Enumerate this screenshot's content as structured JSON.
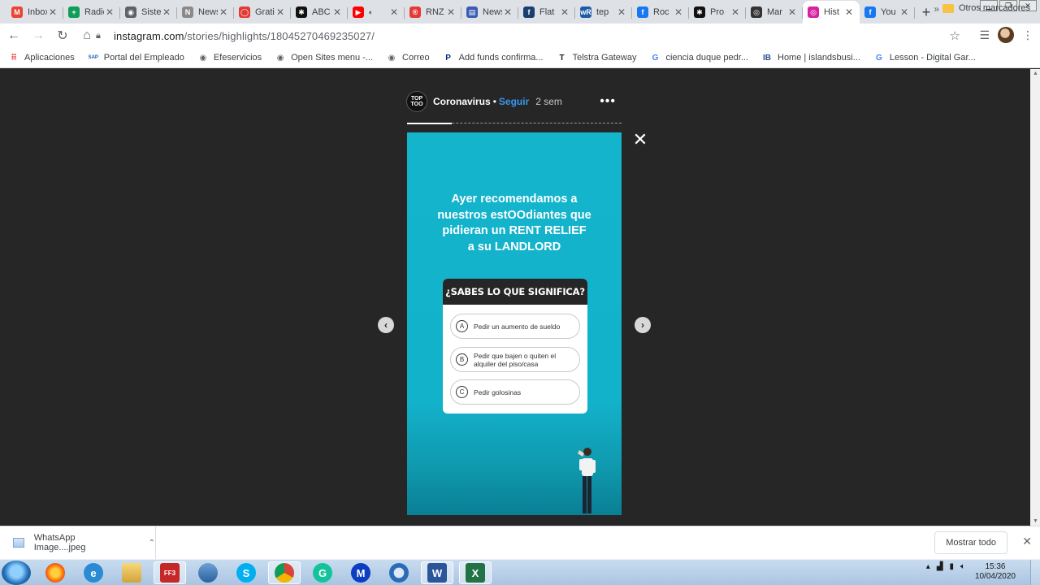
{
  "tabs": [
    {
      "label": "Inbox",
      "icon": "gmail-icon",
      "color": "#ea4335",
      "glyph": "M"
    },
    {
      "label": "Radio",
      "icon": "sheets-icon",
      "color": "#0f9d58",
      "glyph": "+"
    },
    {
      "label": "Sistema",
      "icon": "globe-icon",
      "color": "#5f6368",
      "glyph": "◉"
    },
    {
      "label": "News",
      "icon": "newsletter-icon",
      "color": "#8a8a8a",
      "glyph": "N"
    },
    {
      "label": "Gratis",
      "icon": "chat-bubble-icon",
      "color": "#e53935",
      "glyph": "◯"
    },
    {
      "label": "ABC",
      "icon": "abc-icon",
      "color": "#111111",
      "glyph": "✱"
    },
    {
      "label": "",
      "icon": "youtube-icon",
      "color": "#ff0000",
      "glyph": "▶"
    },
    {
      "label": "RNZ",
      "icon": "rnz-icon",
      "color": "#e53935",
      "glyph": "®"
    },
    {
      "label": "News",
      "icon": "news-flag-icon",
      "color": "#3b5bb5",
      "glyph": "▤"
    },
    {
      "label": "Flat",
      "icon": "flatmates-icon",
      "color": "#1a3f6f",
      "glyph": "f"
    },
    {
      "label": "tep",
      "icon": "wordreference-icon",
      "color": "#1e5aa8",
      "glyph": "wR"
    },
    {
      "label": "Roc",
      "icon": "facebook-icon",
      "color": "#1877f2",
      "glyph": "f"
    },
    {
      "label": "Pro",
      "icon": "abc-icon",
      "color": "#111111",
      "glyph": "✱"
    },
    {
      "label": "Mar",
      "icon": "radio-icon",
      "color": "#333333",
      "glyph": "◎"
    },
    {
      "label": "Hist",
      "icon": "instagram-icon",
      "color": "#d6249f",
      "glyph": "◎"
    },
    {
      "label": "You",
      "icon": "facebook-icon",
      "color": "#1877f2",
      "glyph": "f"
    }
  ],
  "address": {
    "domain": "instagram.com",
    "path": "/stories/highlights/18045270469235027/"
  },
  "bookmarks": [
    {
      "label": "Aplicaciones",
      "icon": "apps-grid-icon"
    },
    {
      "label": "Portal del Empleado",
      "icon": "sap-icon"
    },
    {
      "label": "Efeservicios",
      "icon": "globe-icon"
    },
    {
      "label": "Open Sites menu -...",
      "icon": "globe-icon"
    },
    {
      "label": "Correo",
      "icon": "globe-icon"
    },
    {
      "label": "Add funds confirma...",
      "icon": "paypal-icon"
    },
    {
      "label": "Telstra Gateway",
      "icon": "telstra-icon"
    },
    {
      "label": "ciencia duque pedr...",
      "icon": "google-icon"
    },
    {
      "label": "Home | islandsbusi...",
      "icon": "ib-icon"
    },
    {
      "label": "Lesson - Digital Gar...",
      "icon": "google-icon"
    }
  ],
  "bookmarks_more": "»",
  "bookmarks_other": "Otros marcadores",
  "story": {
    "logo_text": "TOP TOO",
    "account": "Coronavirus",
    "dot": "•",
    "follow": "Seguir",
    "time": "2 sem",
    "more": "•••",
    "progress": 0.21,
    "caption_lines": [
      "Ayer recomendamos a",
      "nuestros estOOdiantes que",
      "pidieran un RENT RELIEF",
      "a su LANDLORD"
    ],
    "quiz_title": "¿SABES LO QUE SIGNIFICA?",
    "options": [
      {
        "letter": "A",
        "text": "Pedir un aumento de sueldo"
      },
      {
        "letter": "B",
        "text": "Pedir que bajen o quiten el alquiler del piso/casa"
      },
      {
        "letter": "C",
        "text": "Pedir golosinas"
      }
    ],
    "close": "✕",
    "prev": "‹",
    "next": "›"
  },
  "download": {
    "filename": "WhatsApp Image....jpeg",
    "show_all": "Mostrar todo"
  },
  "taskbar": {
    "apps": [
      "firefox-icon",
      "ie-icon",
      "explorer-icon",
      "ff3-icon",
      "network-icon",
      "skype-icon",
      "chrome-icon",
      "grammarly-icon",
      "malwarebytes-icon",
      "thunderbird-icon",
      "word-icon",
      "excel-icon"
    ],
    "time": "15:36",
    "date": "10/04/2020"
  },
  "colors": {
    "accent_follow": "#3897f0",
    "story_bg": "#13b4cc",
    "viewport_bg": "#262626"
  }
}
